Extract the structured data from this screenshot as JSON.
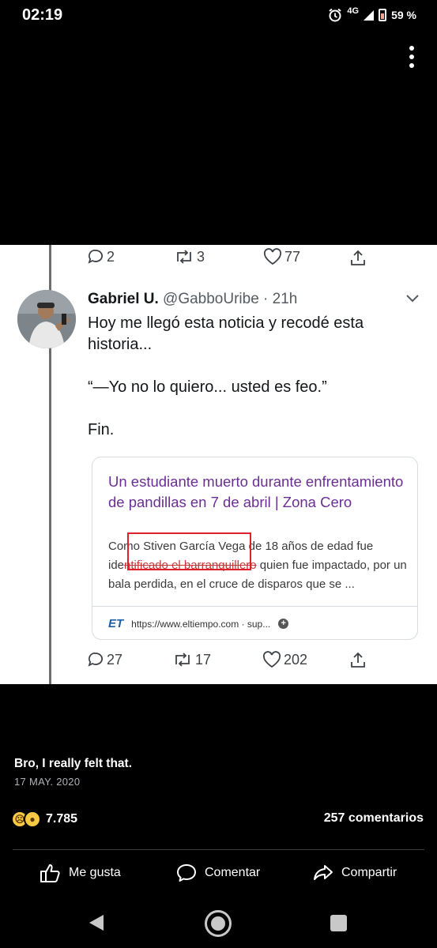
{
  "status_bar": {
    "time": "02:19",
    "network": "4G",
    "battery": "59 %"
  },
  "tweet_prev_actions": {
    "replies": "2",
    "retweets": "3",
    "likes": "77"
  },
  "tweet": {
    "name": "Gabriel U.",
    "handle": "@GabboUribe · 21h",
    "body": [
      "Hoy me llegó esta noticia y recodé esta",
      "historia..."
    ],
    "quote": "“—Yo no lo quiero... usted es feo.”",
    "ending": "Fin.",
    "card": {
      "title": "Un estudiante muerto durante enfrentamiento de pandillas en 7 de abril | Zona Cero",
      "desc_1": "Com",
      "desc_highlight": "o Stiven García Vega",
      "desc_2": " de 18 años de edad fue",
      "desc_3": "ide",
      "desc_strike": "ntificado el barranquillero",
      "desc_4": " quien fue impactado, por un",
      "desc_5": "bala perdida, en el cruce de disparos que se ...",
      "source_logo": "ET",
      "url": "https://www.eltiempo.com · sup..."
    },
    "actions": {
      "replies": "27",
      "retweets": "17",
      "likes": "202"
    }
  },
  "post": {
    "caption": "Bro, I really felt that.",
    "date": "17 MAY. 2020",
    "reaction_count": "7.785",
    "comments": "257 comentarios",
    "buttons": {
      "like": "Me gusta",
      "comment": "Comentar",
      "share": "Compartir"
    }
  },
  "colors": {
    "link_purple": "#6a2f94",
    "highlight_red": "#e0202a",
    "background": "#000000"
  },
  "icons": [
    "alarm-icon",
    "signal-icon",
    "battery-icon",
    "more-vert-icon",
    "reply-icon",
    "retweet-icon",
    "like-icon",
    "share-icon",
    "chevron-down-icon",
    "thumbs-up-icon",
    "comment-icon",
    "share-arrow-icon"
  ]
}
